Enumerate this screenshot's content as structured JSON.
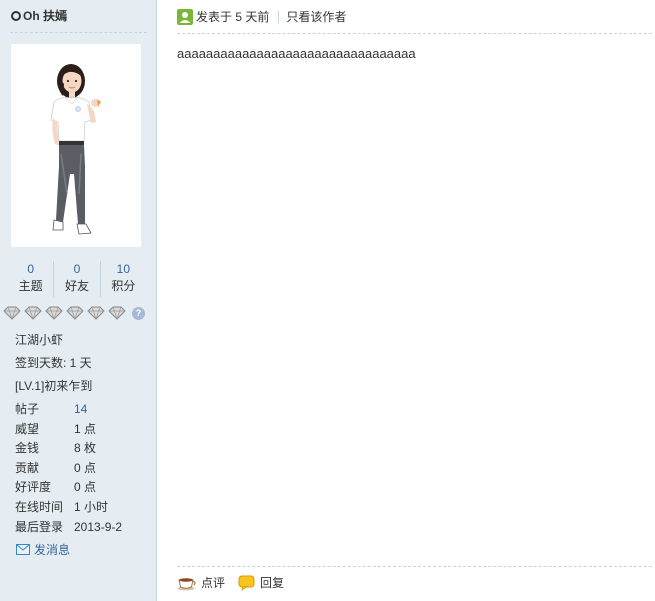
{
  "sidebar": {
    "username": "Oh 扶嫣",
    "stats": [
      {
        "value": "0",
        "label": "主题"
      },
      {
        "value": "0",
        "label": "好友"
      },
      {
        "value": "10",
        "label": "积分"
      }
    ],
    "help_glyph": "?",
    "rank": "江湖小虾",
    "signin": "签到天数: 1 天",
    "level": "[LV.1]初来乍到",
    "info": [
      {
        "key": "帖子",
        "value": "14"
      },
      {
        "key": "威望",
        "value": "1 点"
      },
      {
        "key": "金钱",
        "value": "8 枚"
      },
      {
        "key": "贡献",
        "value": "0 点"
      },
      {
        "key": "好评度",
        "value": "0 点"
      },
      {
        "key": "在线时间",
        "value": "1 小时"
      },
      {
        "key": "最后登录",
        "value": "2013-9-2"
      }
    ],
    "send_message": "发消息"
  },
  "post": {
    "posted_at": "发表于 5 天前",
    "only_author": "只看该作者",
    "body": "aaaaaaaaaaaaaaaaaaaaaaaaaaaaaaaaa",
    "actions": {
      "comment": "点评",
      "reply": "回复"
    }
  },
  "colors": {
    "sidebar_bg": "#e5edf2",
    "border": "#c2d5e3",
    "link": "#336699"
  }
}
